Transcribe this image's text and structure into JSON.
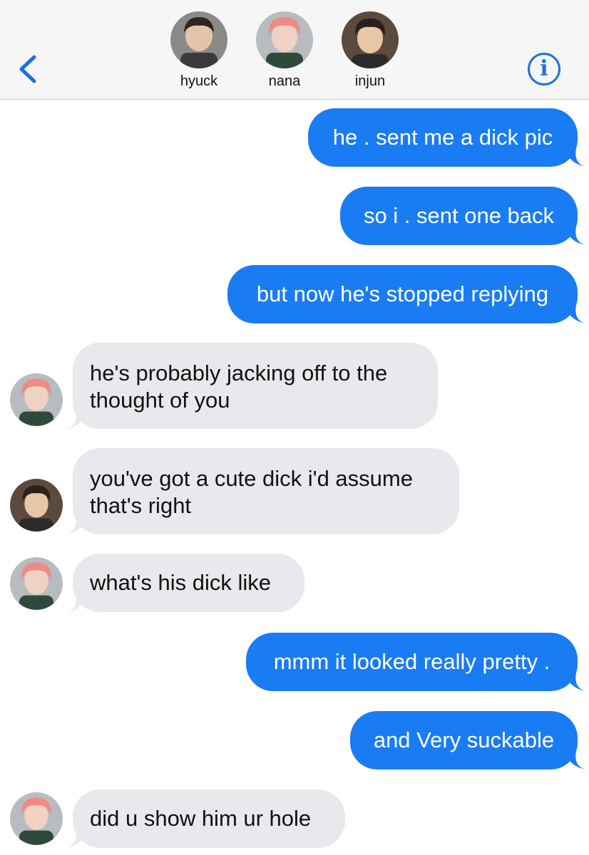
{
  "header": {
    "participants": [
      {
        "name": "hyuck",
        "avatar": "hyuck-avatar"
      },
      {
        "name": "nana",
        "avatar": "nana-avatar"
      },
      {
        "name": "injun",
        "avatar": "injun-avatar"
      }
    ],
    "back_icon": "chevron-left-icon",
    "info_icon": "info-icon",
    "info_glyph": "i"
  },
  "colors": {
    "outgoing_bubble": "#1a7cf3",
    "incoming_bubble": "#e9e9ed",
    "accent": "#1a73d9",
    "header_bg": "#f6f6f7"
  },
  "messages": [
    {
      "direction": "out",
      "lines": [
        "he . sent me a dick pic"
      ]
    },
    {
      "direction": "out",
      "lines": [
        "so i . sent one back"
      ]
    },
    {
      "direction": "out",
      "lines": [
        "but now he's stopped replying"
      ]
    },
    {
      "direction": "in",
      "sender": "nana",
      "lines": [
        "he's probably jacking off to the",
        "thought of you"
      ]
    },
    {
      "direction": "in",
      "sender": "injun",
      "lines": [
        "you've got a cute dick i'd assume",
        "that's right"
      ]
    },
    {
      "direction": "in",
      "sender": "nana",
      "lines": [
        "what's his dick like"
      ]
    },
    {
      "direction": "out",
      "lines": [
        "mmm it looked really pretty ."
      ]
    },
    {
      "direction": "out",
      "lines": [
        "and Very suckable"
      ]
    },
    {
      "direction": "in",
      "sender": "nana",
      "lines": [
        "did u show him ur hole"
      ]
    }
  ]
}
